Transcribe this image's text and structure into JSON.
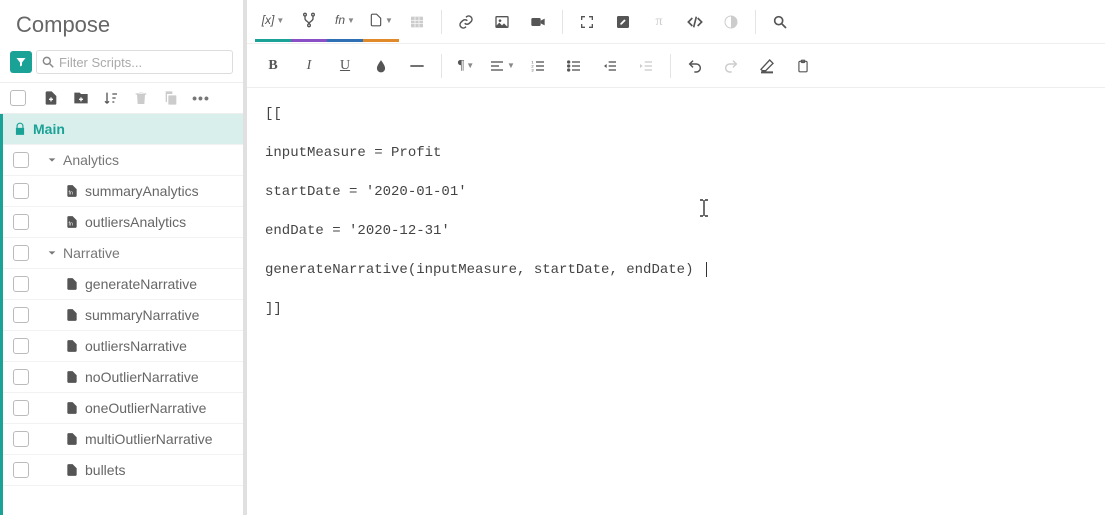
{
  "sidebar": {
    "title": "Compose",
    "filter_placeholder": "Filter Scripts...",
    "main_label": "Main",
    "tree": {
      "folders": [
        {
          "label": "Analytics",
          "files": [
            {
              "label": "summaryAnalytics",
              "icon": "code"
            },
            {
              "label": "outliersAnalytics",
              "icon": "code"
            }
          ]
        },
        {
          "label": "Narrative",
          "files": [
            {
              "label": "generateNarrative",
              "icon": "file"
            },
            {
              "label": "summaryNarrative",
              "icon": "file"
            },
            {
              "label": "outliersNarrative",
              "icon": "file"
            },
            {
              "label": "noOutlierNarrative",
              "icon": "file"
            },
            {
              "label": "oneOutlierNarrative",
              "icon": "file"
            },
            {
              "label": "multiOutlierNarrative",
              "icon": "file"
            },
            {
              "label": "bullets",
              "icon": "file"
            }
          ]
        }
      ]
    }
  },
  "editor": {
    "code_lines": [
      "[[",
      "inputMeasure = Profit",
      "startDate = '2020-01-01'",
      "endDate = '2020-12-31'",
      "generateNarrative(inputMeasure, startDate, endDate) ",
      "]]"
    ]
  }
}
